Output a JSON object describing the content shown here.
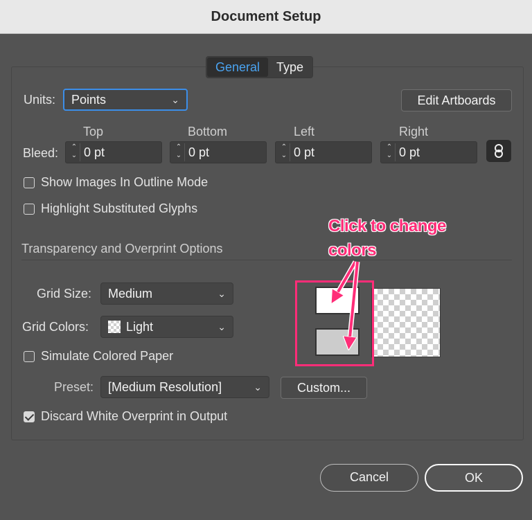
{
  "window": {
    "title": "Document Setup"
  },
  "tabs": [
    {
      "label": "General",
      "active": true
    },
    {
      "label": "Type",
      "active": false
    }
  ],
  "units": {
    "label": "Units:",
    "value": "Points"
  },
  "edit_artboards_label": "Edit Artboards",
  "bleed": {
    "label": "Bleed:",
    "fields": [
      {
        "header": "Top",
        "value": "0 pt"
      },
      {
        "header": "Bottom",
        "value": "0 pt"
      },
      {
        "header": "Left",
        "value": "0 pt"
      },
      {
        "header": "Right",
        "value": "0 pt"
      }
    ],
    "link_icon": "chain-link-icon"
  },
  "checkboxes": {
    "show_images_outline": {
      "label": "Show Images In Outline Mode",
      "checked": false
    },
    "highlight_glyphs": {
      "label": "Highlight Substituted Glyphs",
      "checked": false
    },
    "simulate_paper": {
      "label": "Simulate Colored Paper",
      "checked": false
    },
    "discard_white": {
      "label": "Discard White Overprint in Output",
      "checked": true
    }
  },
  "transparency": {
    "section_title": "Transparency and Overprint Options",
    "grid_size": {
      "label": "Grid Size:",
      "value": "Medium"
    },
    "grid_colors": {
      "label": "Grid Colors:",
      "value": "Light",
      "swatch_icon": "checker-swatch-icon"
    },
    "preset": {
      "label": "Preset:",
      "value": "[Medium Resolution]"
    },
    "custom_label": "Custom...",
    "swatch_top_color": "#ffffff",
    "swatch_bottom_color": "#cccccc"
  },
  "annotation": {
    "line1": "Click to change",
    "line2": "colors",
    "color": "#ff2d78"
  },
  "buttons": {
    "cancel": "Cancel",
    "ok": "OK"
  }
}
